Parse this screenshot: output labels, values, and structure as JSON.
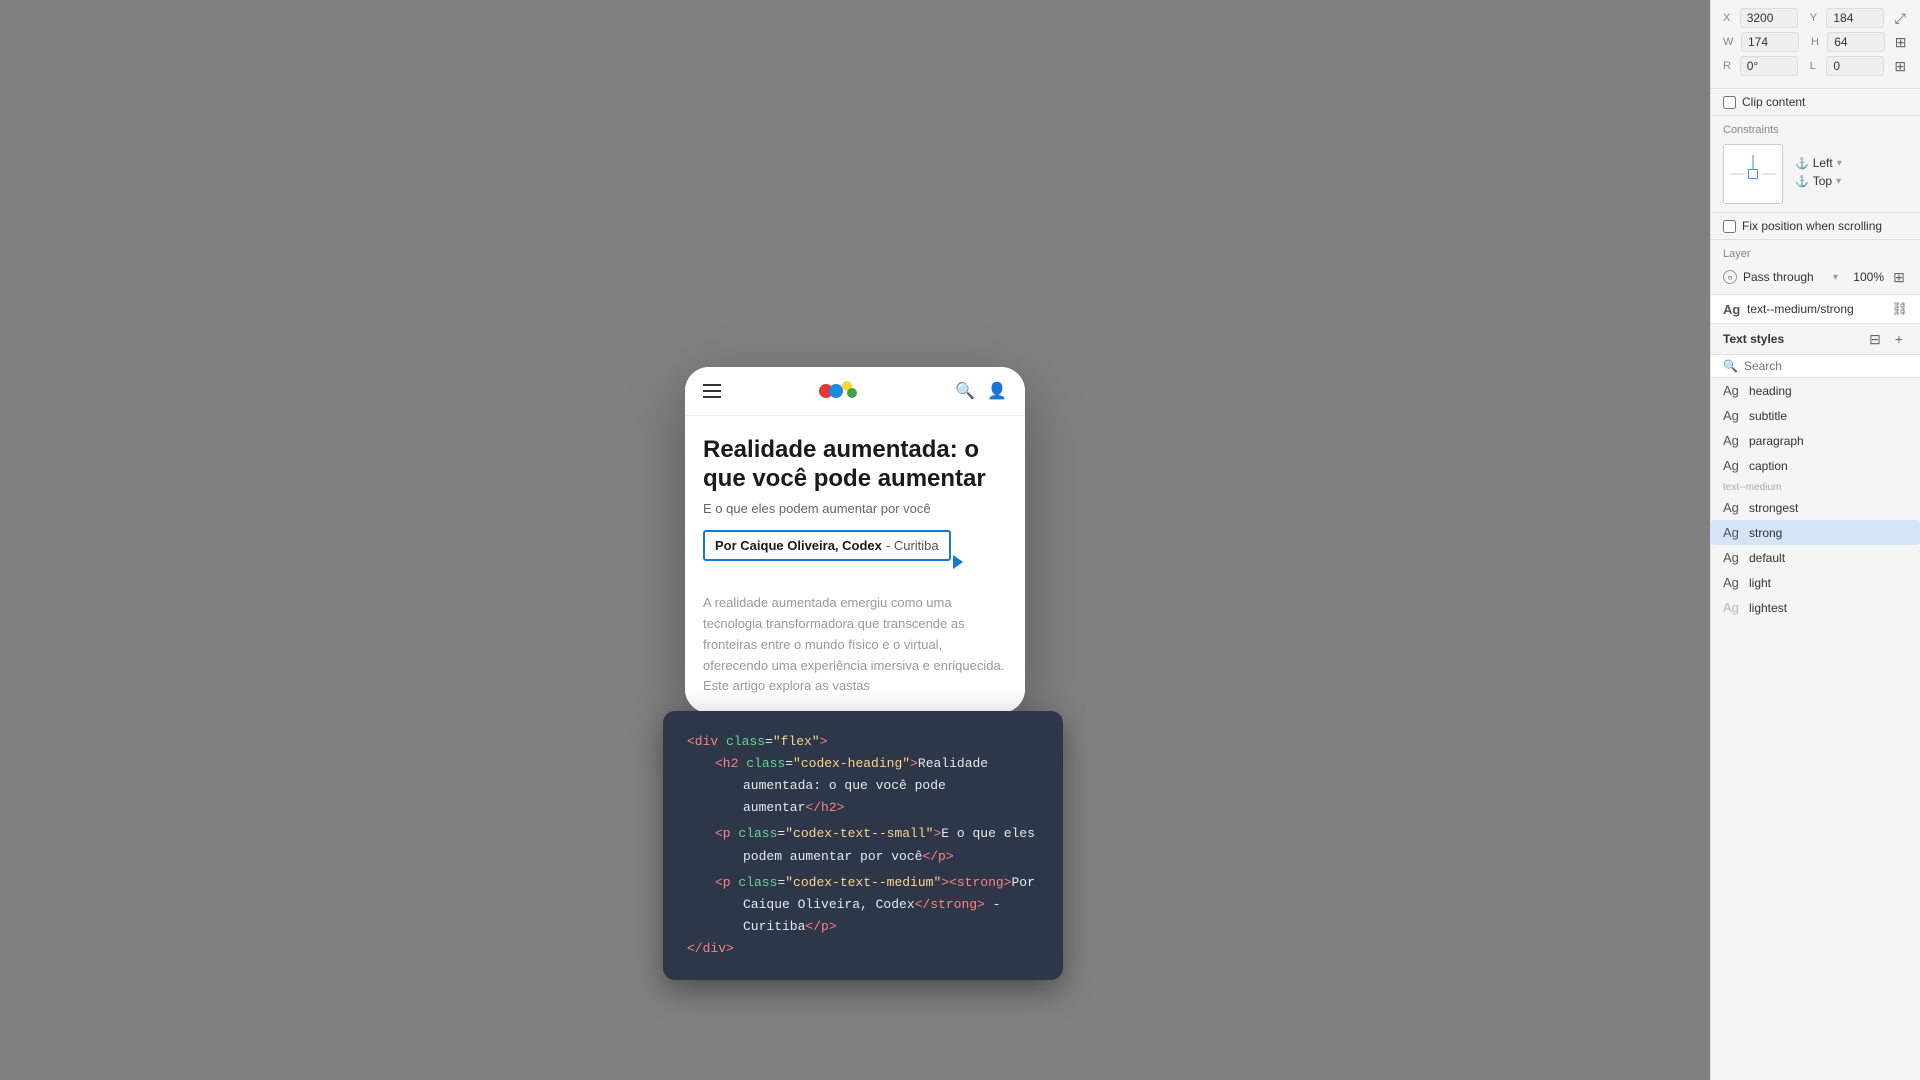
{
  "panel": {
    "coords": {
      "x_label": "X",
      "y_label": "Y",
      "x_value": "3200",
      "y_value": "184",
      "w_label": "W",
      "h_label": "H",
      "w_value": "174",
      "h_value": "64",
      "r_label": "R",
      "l_label": "L",
      "r_value": "0°",
      "l_value": "0"
    },
    "clip": {
      "label": "Clip content"
    },
    "constraints": {
      "title": "Constraints",
      "left_label": "Left",
      "top_label": "Top"
    },
    "fix_position": {
      "label": "Fix position when scrolling"
    },
    "layer": {
      "title": "Layer",
      "mode": "Pass through",
      "opacity": "100%"
    },
    "current_style": {
      "ag": "Ag",
      "name": "text--medium/strong"
    },
    "text_styles": {
      "title": "Text styles",
      "search_placeholder": "Search",
      "category_text_medium": "text--medium",
      "styles": [
        {
          "ag": "Ag",
          "name": "heading",
          "active": false
        },
        {
          "ag": "Ag",
          "name": "subtitle",
          "active": false
        },
        {
          "ag": "Ag",
          "name": "paragraph",
          "active": false
        },
        {
          "ag": "Ag",
          "name": "caption",
          "active": false
        },
        {
          "ag": "Ag",
          "name": "strongest",
          "active": false
        },
        {
          "ag": "Ag",
          "name": "strong",
          "active": true
        },
        {
          "ag": "Ag",
          "name": "default",
          "active": false
        },
        {
          "ag": "Ag",
          "name": "light",
          "active": false
        },
        {
          "ag": "Ag",
          "name": "lightest",
          "active": false
        }
      ]
    }
  },
  "phone": {
    "title": "Realidade aumentada: o que você pode aumentar",
    "subtitle": "E o que eles podem aumentar por você",
    "author": "Por Caique Oliveira, Codex",
    "author_location": " - Curitiba",
    "body": "A realidade aumentada emergiu como uma tecnologia transformadora que transcende as fronteiras entre o mundo físico e o virtual, oferecendo uma experiência imersiva e enriquecida. Este artigo explora as vastas"
  },
  "code": {
    "line1": "<div class=\"flex\">",
    "line2_open": "<h2 class=\"codex-heading\">Realidade",
    "line2_mid": "aumentada: o que você pode aumentar",
    "line2_close": "</h2>",
    "line3_open": "<p class=\"codex-text--small\">E o que eles",
    "line3_mid": "podem aumentar por você",
    "line3_close": "</p>",
    "line4_open": "<p class=\"codex-text--medium\"><strong>Por",
    "line4_mid": "Caique Oliveira, Codex</strong> -",
    "line4_end": "Curitiba</p>",
    "line5": "</div>"
  },
  "icons": {
    "hamburger": "☰",
    "search": "🔍",
    "account": "👤",
    "search_sm": "🔍",
    "plus": "+",
    "sliders": "⊞"
  }
}
